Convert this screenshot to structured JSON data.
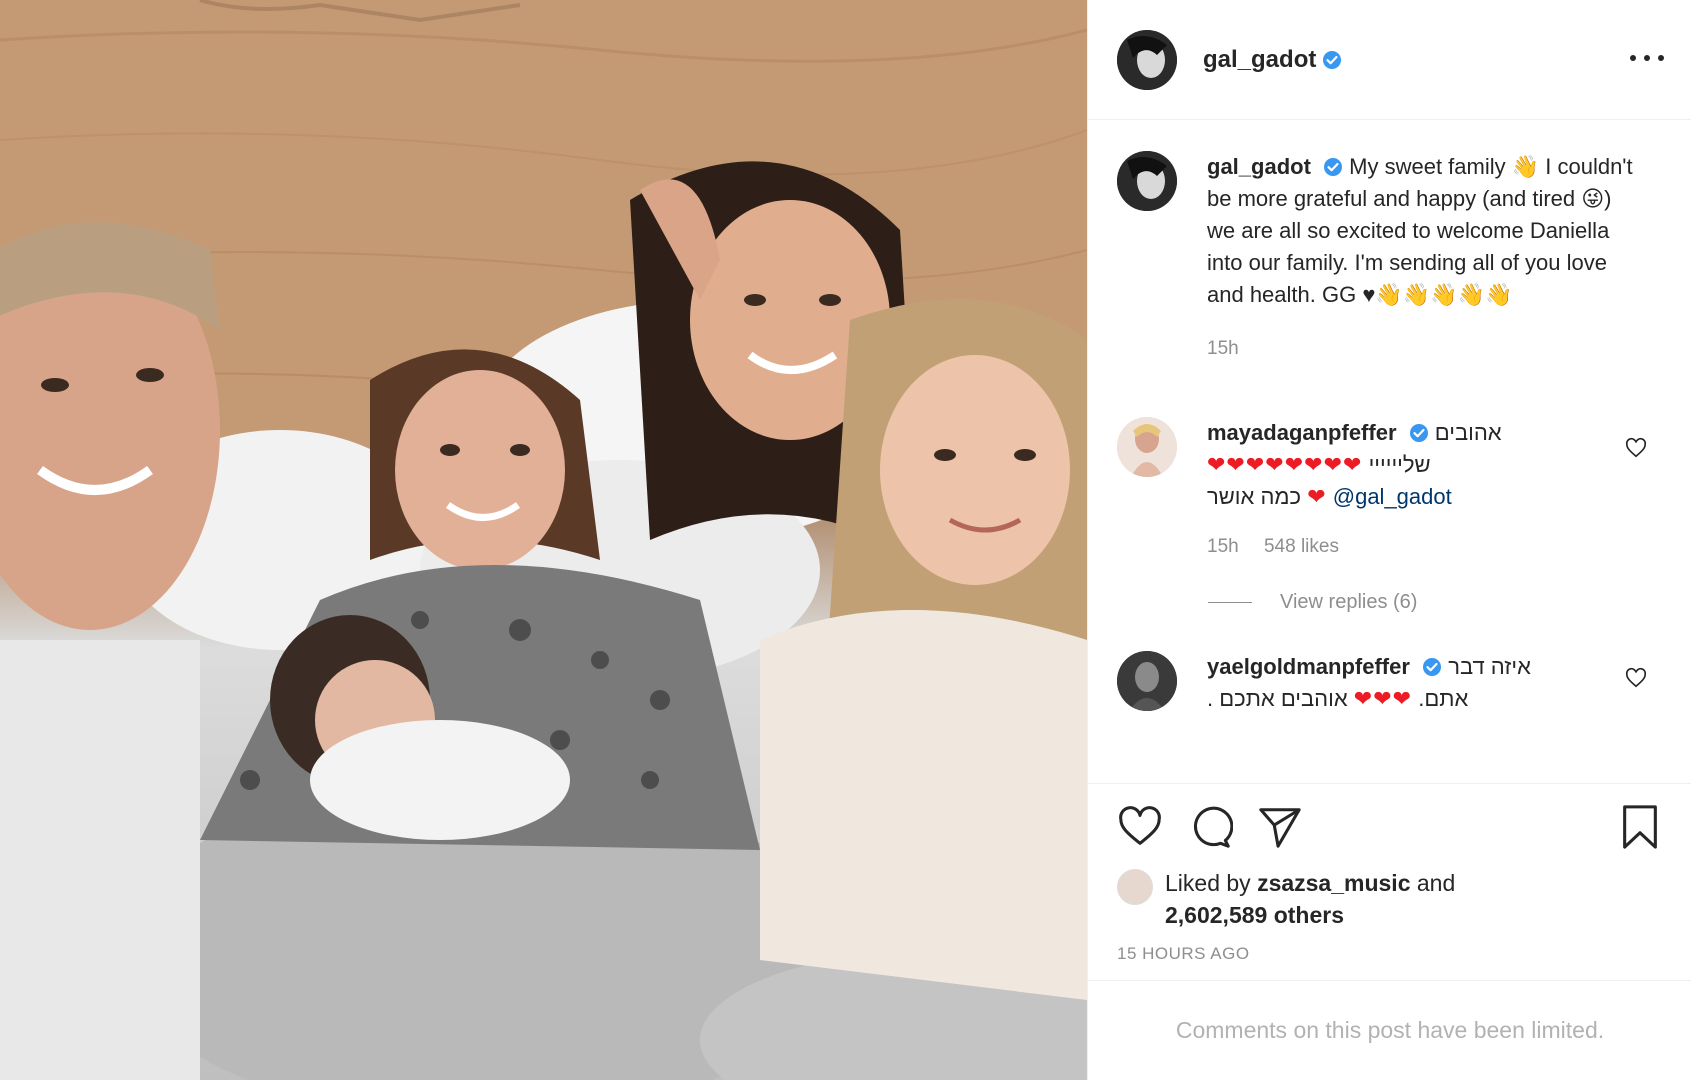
{
  "post": {
    "author": "gal_gadot",
    "more_label": "More options"
  },
  "caption": {
    "username": "gal_gadot",
    "text": "My sweet family 👋 I couldn't be more grateful and happy (and tired 😜) we are all so excited to welcome Daniella into our family. I'm sending all of you love and health. GG ♥👋👋👋👋👋",
    "time": "15h"
  },
  "comments": [
    {
      "username": "mayadaganpfeffer",
      "text_rtl_1": "אהובים",
      "text_rtl_2": "שליייייי",
      "hearts": "❤❤❤❤❤❤❤❤",
      "text_rtl_3": "כמה אושר",
      "heart_single": "❤",
      "mention": "@gal_gadot",
      "time": "15h",
      "likes": "548 likes"
    },
    {
      "username": "yaelgoldmanpfeffer",
      "text_rtl_1": "איזה דבר",
      "text_rtl_2": "אתם.",
      "hearts": "❤❤❤",
      "text_rtl_3": "אוהבים אתכם ."
    }
  ],
  "view_replies": "View replies (6)",
  "liked_by": {
    "prefix": "Liked by",
    "user": "zsazsa_music",
    "and": "and",
    "others": "2,602,589 others"
  },
  "timestamp": "15 HOURS AGO",
  "limited_notice": "Comments on this post have been limited.",
  "colors": {
    "verified": "#3897f0",
    "heart_red": "#ed1c24",
    "secondary_text": "#8e8e8e"
  },
  "icons": [
    "heart-icon",
    "comment-icon",
    "share-icon",
    "bookmark-icon",
    "more-icon",
    "verified-badge-icon"
  ]
}
